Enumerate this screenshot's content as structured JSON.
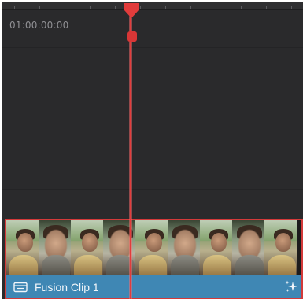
{
  "timeline": {
    "start_timecode": "01:00:00:00"
  },
  "clip": {
    "label": "Fusion Clip 1",
    "type_icon": "clip-icon",
    "effect_icon": "sparkle-icon",
    "bar_color": "#3f87b4",
    "selection_color": "#d33a3a"
  },
  "playhead": {
    "color": "#e23c3c"
  }
}
